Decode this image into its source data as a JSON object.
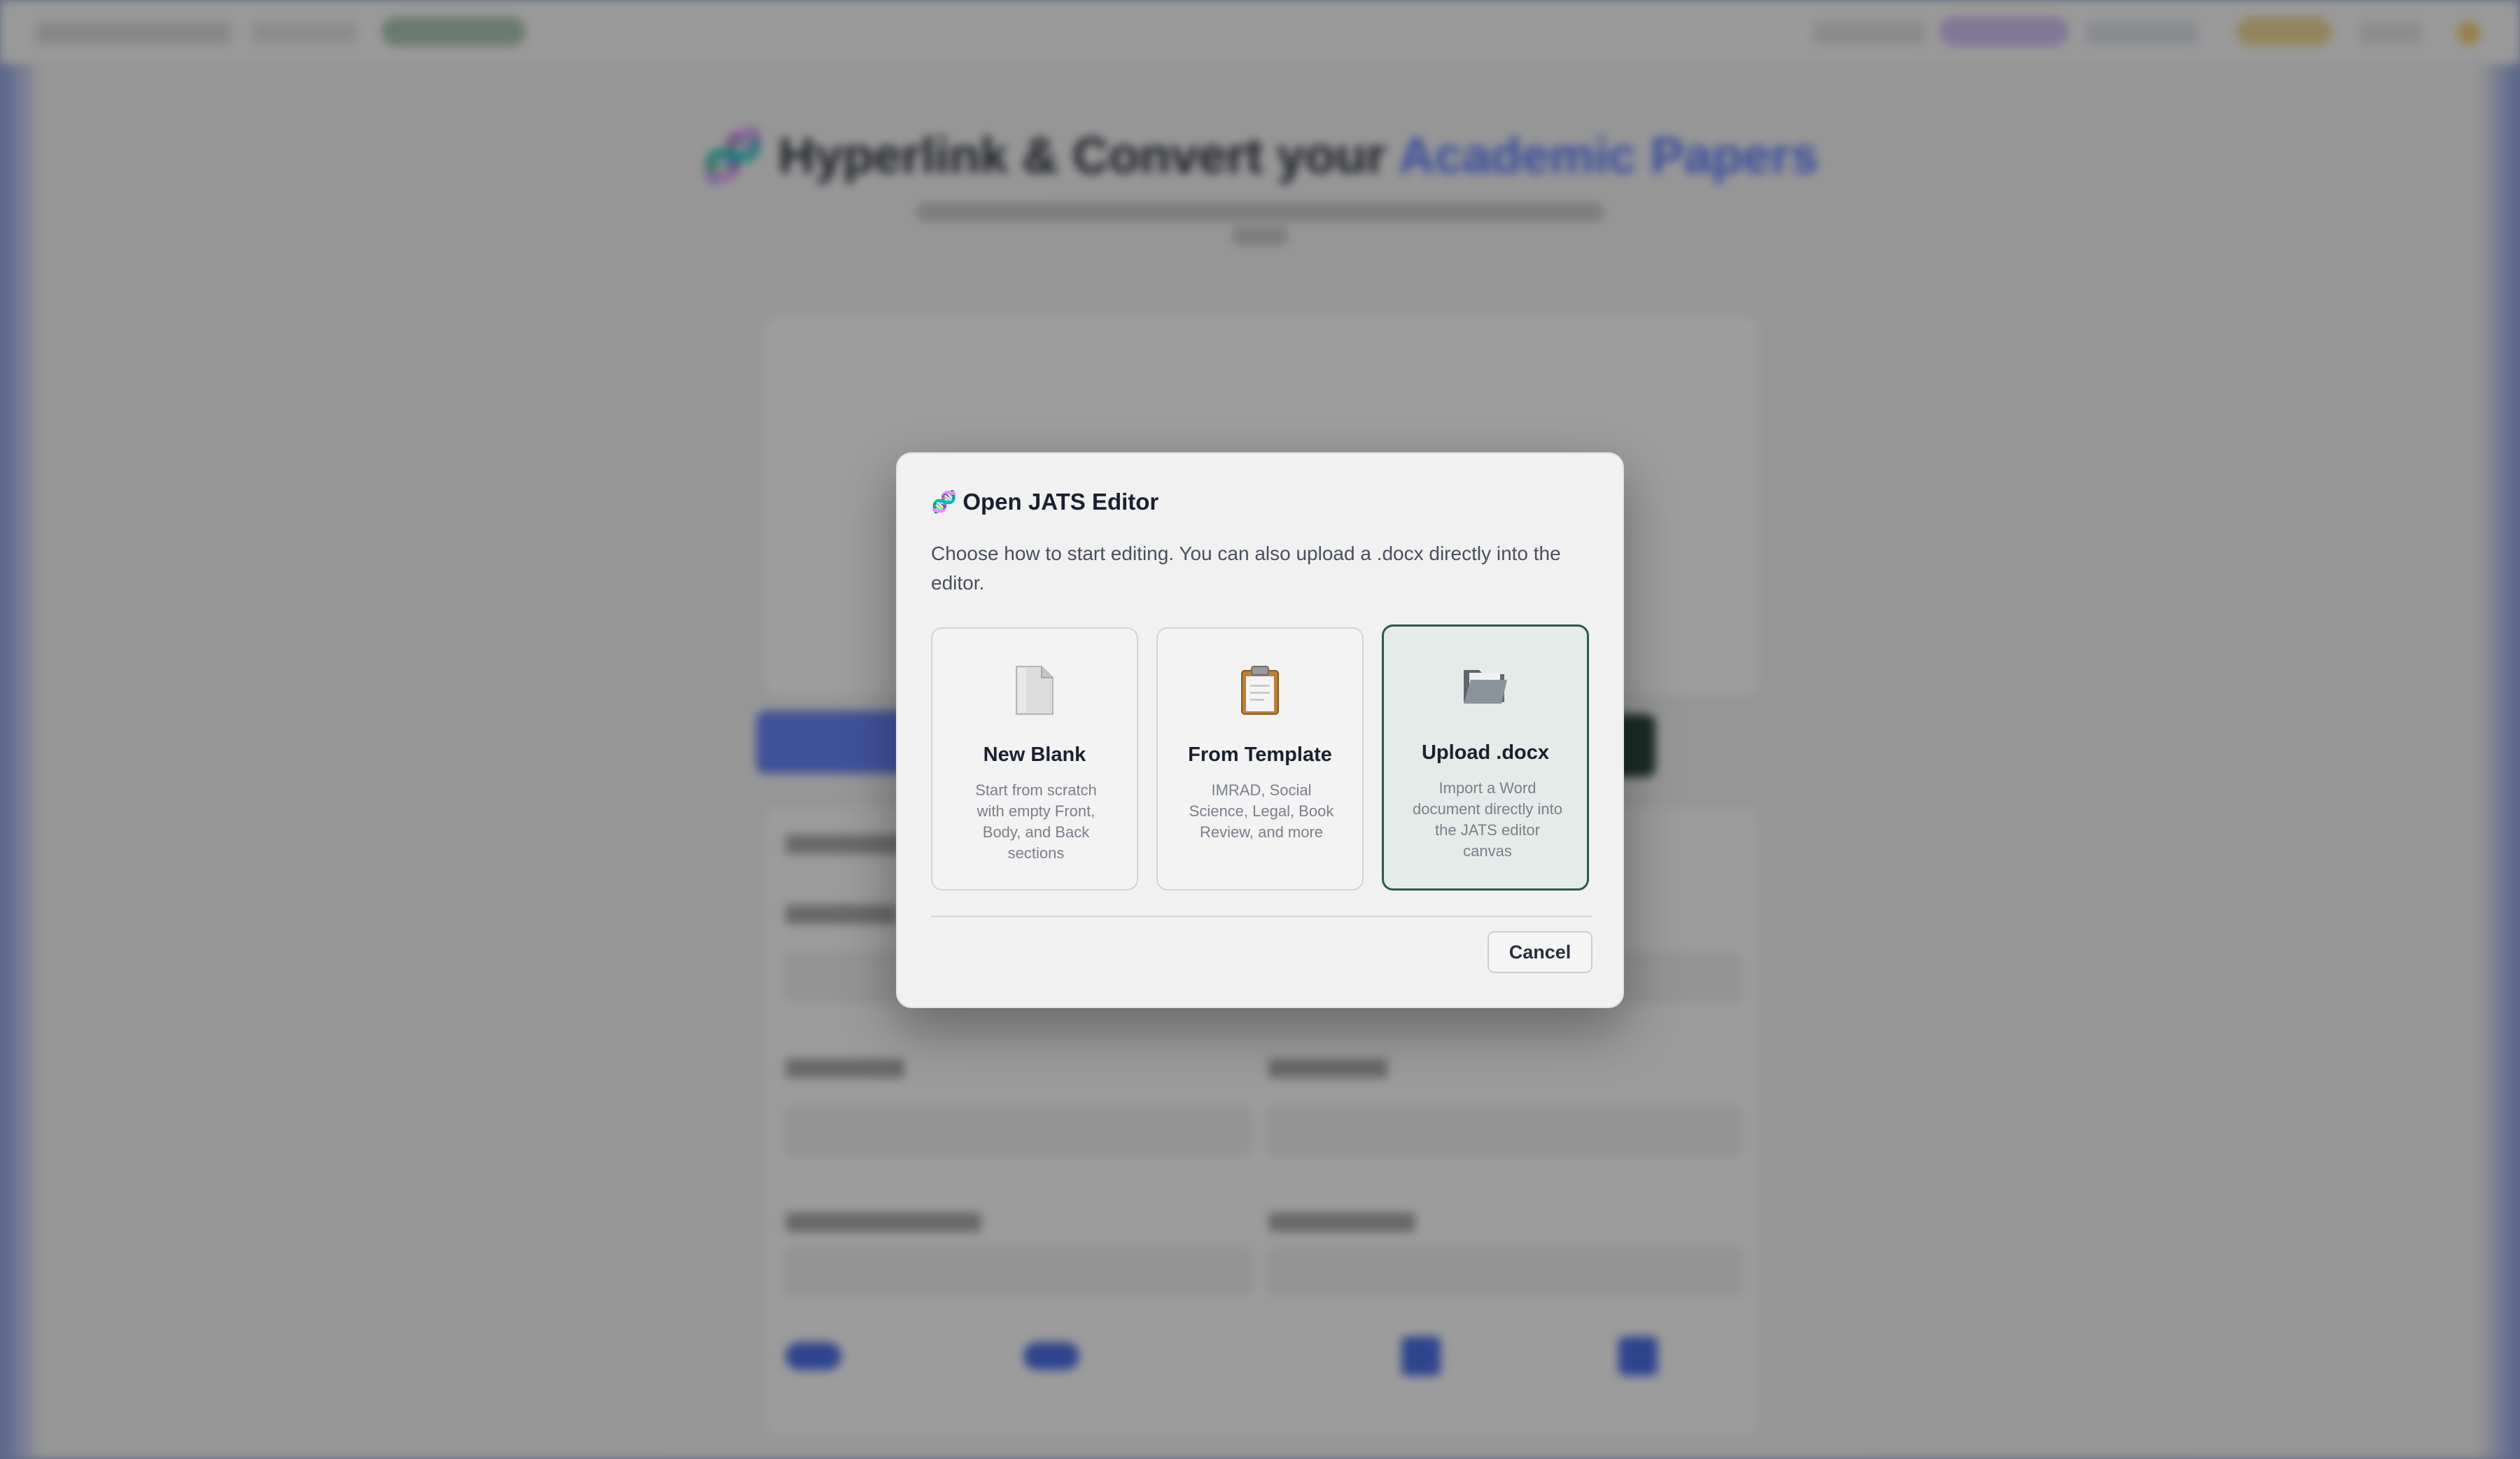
{
  "modal": {
    "title_emoji": "🧬",
    "title": "Open JATS Editor",
    "description": "Choose how to start editing. You can also upload a .docx directly into the editor.",
    "options": [
      {
        "icon": "blank-document-icon",
        "label": "New Blank",
        "description": "Start from scratch with empty Front, Body, and Back sections",
        "selected": false
      },
      {
        "icon": "clipboard-icon",
        "label": "From Template",
        "description": "IMRAD, Social Science, Legal, Book Review, and more",
        "selected": false
      },
      {
        "icon": "folder-icon",
        "label": "Upload .docx",
        "description": "Import a Word document directly into the JATS editor canvas",
        "selected": true
      }
    ],
    "cancel_label": "Cancel"
  },
  "background": {
    "heading_prefix": "Hyperlink & Convert your",
    "heading_accent": "Academic Papers",
    "accent_color": "#4a6cf0",
    "selected_border_color": "#2e5a4a"
  }
}
